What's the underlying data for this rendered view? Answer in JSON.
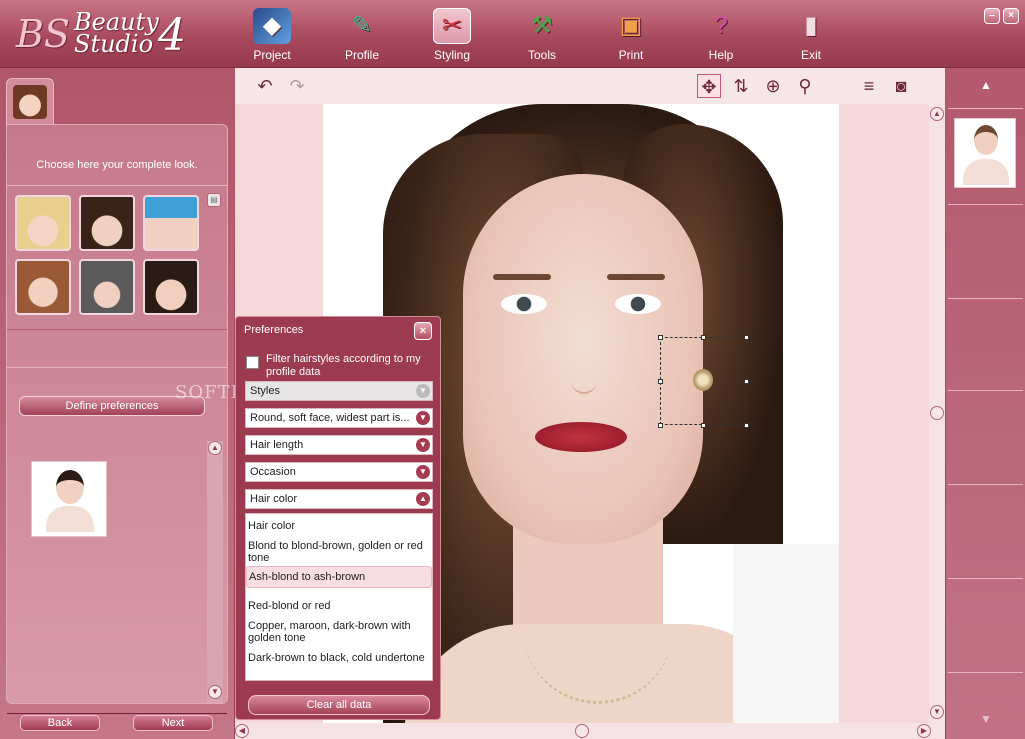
{
  "app": {
    "logo_mark": "BS",
    "logo_line1": "Beauty",
    "logo_line2": "Studio",
    "logo_version": "4"
  },
  "nav": [
    {
      "label": "Project",
      "icon": "project-icon"
    },
    {
      "label": "Profile",
      "icon": "profile-icon"
    },
    {
      "label": "Styling",
      "icon": "styling-icon",
      "active": true
    },
    {
      "label": "Tools",
      "icon": "tools-icon"
    },
    {
      "label": "Print",
      "icon": "print-icon"
    },
    {
      "label": "Help",
      "icon": "help-icon"
    },
    {
      "label": "Exit",
      "icon": "exit-icon"
    }
  ],
  "left": {
    "heading": "Choose here your complete look.",
    "define_preferences": "Define preferences",
    "back": "Back",
    "next": "Next"
  },
  "canvas": {
    "watermark": "SOFTPEDIA"
  },
  "prefs": {
    "title": "Preferences",
    "filter_label": "Filter hairstyles according to my profile data",
    "filter_checked": false,
    "dropdowns": [
      {
        "value": "Styles",
        "disabled": true
      },
      {
        "value": "Round, soft face, widest part is..."
      },
      {
        "value": "Hair length"
      },
      {
        "value": "Occasion"
      },
      {
        "value": "Hair color"
      }
    ],
    "list": [
      {
        "text": "Hair color"
      },
      {
        "text": "Blond to blond-brown, golden or red tone"
      },
      {
        "text": "Ash-blond to ash-brown",
        "selected": true
      },
      {
        "text": "Red-blond or red"
      },
      {
        "text": "Copper, maroon, dark-brown with golden tone"
      },
      {
        "text": "Dark-brown to black, cold undertone"
      }
    ],
    "clear_all": "Clear all data"
  },
  "colors": {
    "accent": "#a84a5e",
    "panel": "#c07384",
    "selected_item": "#f8dde2"
  }
}
